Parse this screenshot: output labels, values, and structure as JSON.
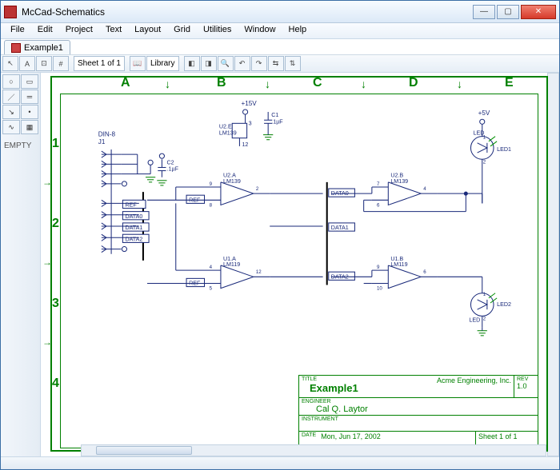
{
  "window": {
    "title": "McCad-Schematics"
  },
  "menu": [
    "File",
    "Edit",
    "Project",
    "Text",
    "Layout",
    "Grid",
    "Utilities",
    "Window",
    "Help"
  ],
  "document": {
    "tab": "Example1"
  },
  "toolbar": {
    "sheet": "Sheet 1 of 1",
    "library": "Library"
  },
  "side": {
    "empty": "EMPTY"
  },
  "grid": {
    "cols": [
      "A",
      "B",
      "C",
      "D",
      "E"
    ],
    "rows": [
      "1",
      "2",
      "3",
      "4"
    ]
  },
  "schematic": {
    "power": {
      "p15v": "+15V",
      "p5v": "+5V"
    },
    "connector": {
      "ref": "DIN-8",
      "des": "J1"
    },
    "cap1": {
      "ref": "C1",
      "val": ".1µF"
    },
    "cap2": {
      "ref": "C2",
      "val": ".1µF"
    },
    "u2e": {
      "ref": "U2.E",
      "part": "LM139",
      "pin_top": "3",
      "pin_bot": "12"
    },
    "u2a": {
      "ref": "U2.A",
      "part": "LM139",
      "pin_p": "9",
      "pin_n": "8",
      "pin_o": "2"
    },
    "u2b": {
      "ref": "U2.B",
      "part": "LM139",
      "pin_p": "7",
      "pin_n": "6",
      "pin_o": "4"
    },
    "u1a": {
      "ref": "U1.A",
      "part": "LM119",
      "pin_p": "4",
      "pin_n": "5",
      "pin_o": "12"
    },
    "u1b": {
      "ref": "U1.B",
      "part": "LM119",
      "pin_p": "9",
      "pin_n": "10",
      "pin_o": "6"
    },
    "led1": {
      "ref": "LED1",
      "part": "LED",
      "pin1": "1",
      "pin2": "2"
    },
    "led2": {
      "ref": "LED2",
      "part": "LED",
      "pin1": "1",
      "pin2": "2"
    },
    "nets": {
      "ref": "REF",
      "data0": "DATA0",
      "data1": "DATA1",
      "data2": "DATA2"
    }
  },
  "titleblock": {
    "title_lab": "TITLE",
    "title": "Example1",
    "company": "Acme Engineering, Inc.",
    "rev_lab": "REV",
    "rev": "1.0",
    "engineer_lab": "ENGINEER",
    "engineer": "Cal Q. Laytor",
    "instrument_lab": "INSTRUMENT",
    "date_lab": "DATE",
    "date": "Mon, Jun 17, 2002",
    "sheet": "Sheet 1 of 1"
  }
}
